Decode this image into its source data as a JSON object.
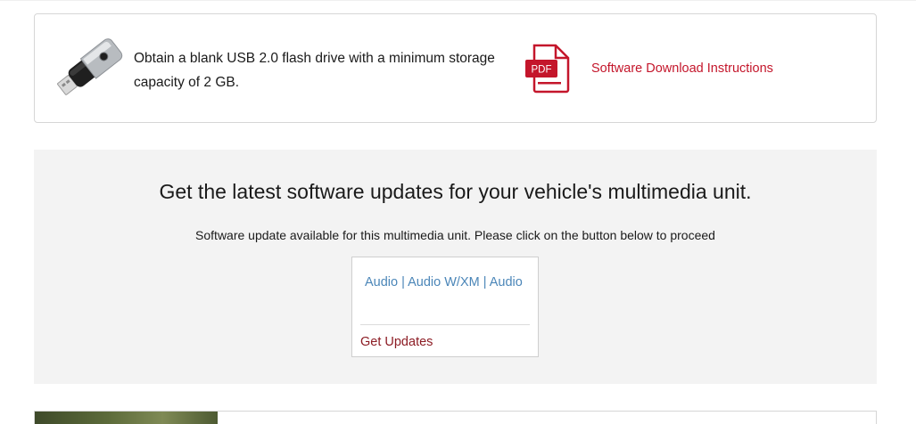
{
  "usb_section": {
    "instruction": "Obtain a blank USB 2.0 flash drive with a minimum storage capacity of 2 GB.",
    "usb_icon": "usb-flash-drive-icon",
    "pdf_icon": "pdf-file-icon",
    "pdf_icon_label": "PDF",
    "instructions_link": "Software Download Instructions"
  },
  "update_section": {
    "title": "Get the latest software updates for your vehicle's multimedia unit.",
    "subtitle": "Software update available for this multimedia unit. Please click on the button below to proceed",
    "unit": {
      "name": "Audio | Audio W/XM | Audio",
      "action": "Get Updates"
    }
  },
  "colors": {
    "link_red": "#c4162b",
    "action_maroon": "#8c1c24",
    "unit_blue": "#4b86b8",
    "panel_bg": "#f3f3f3"
  }
}
